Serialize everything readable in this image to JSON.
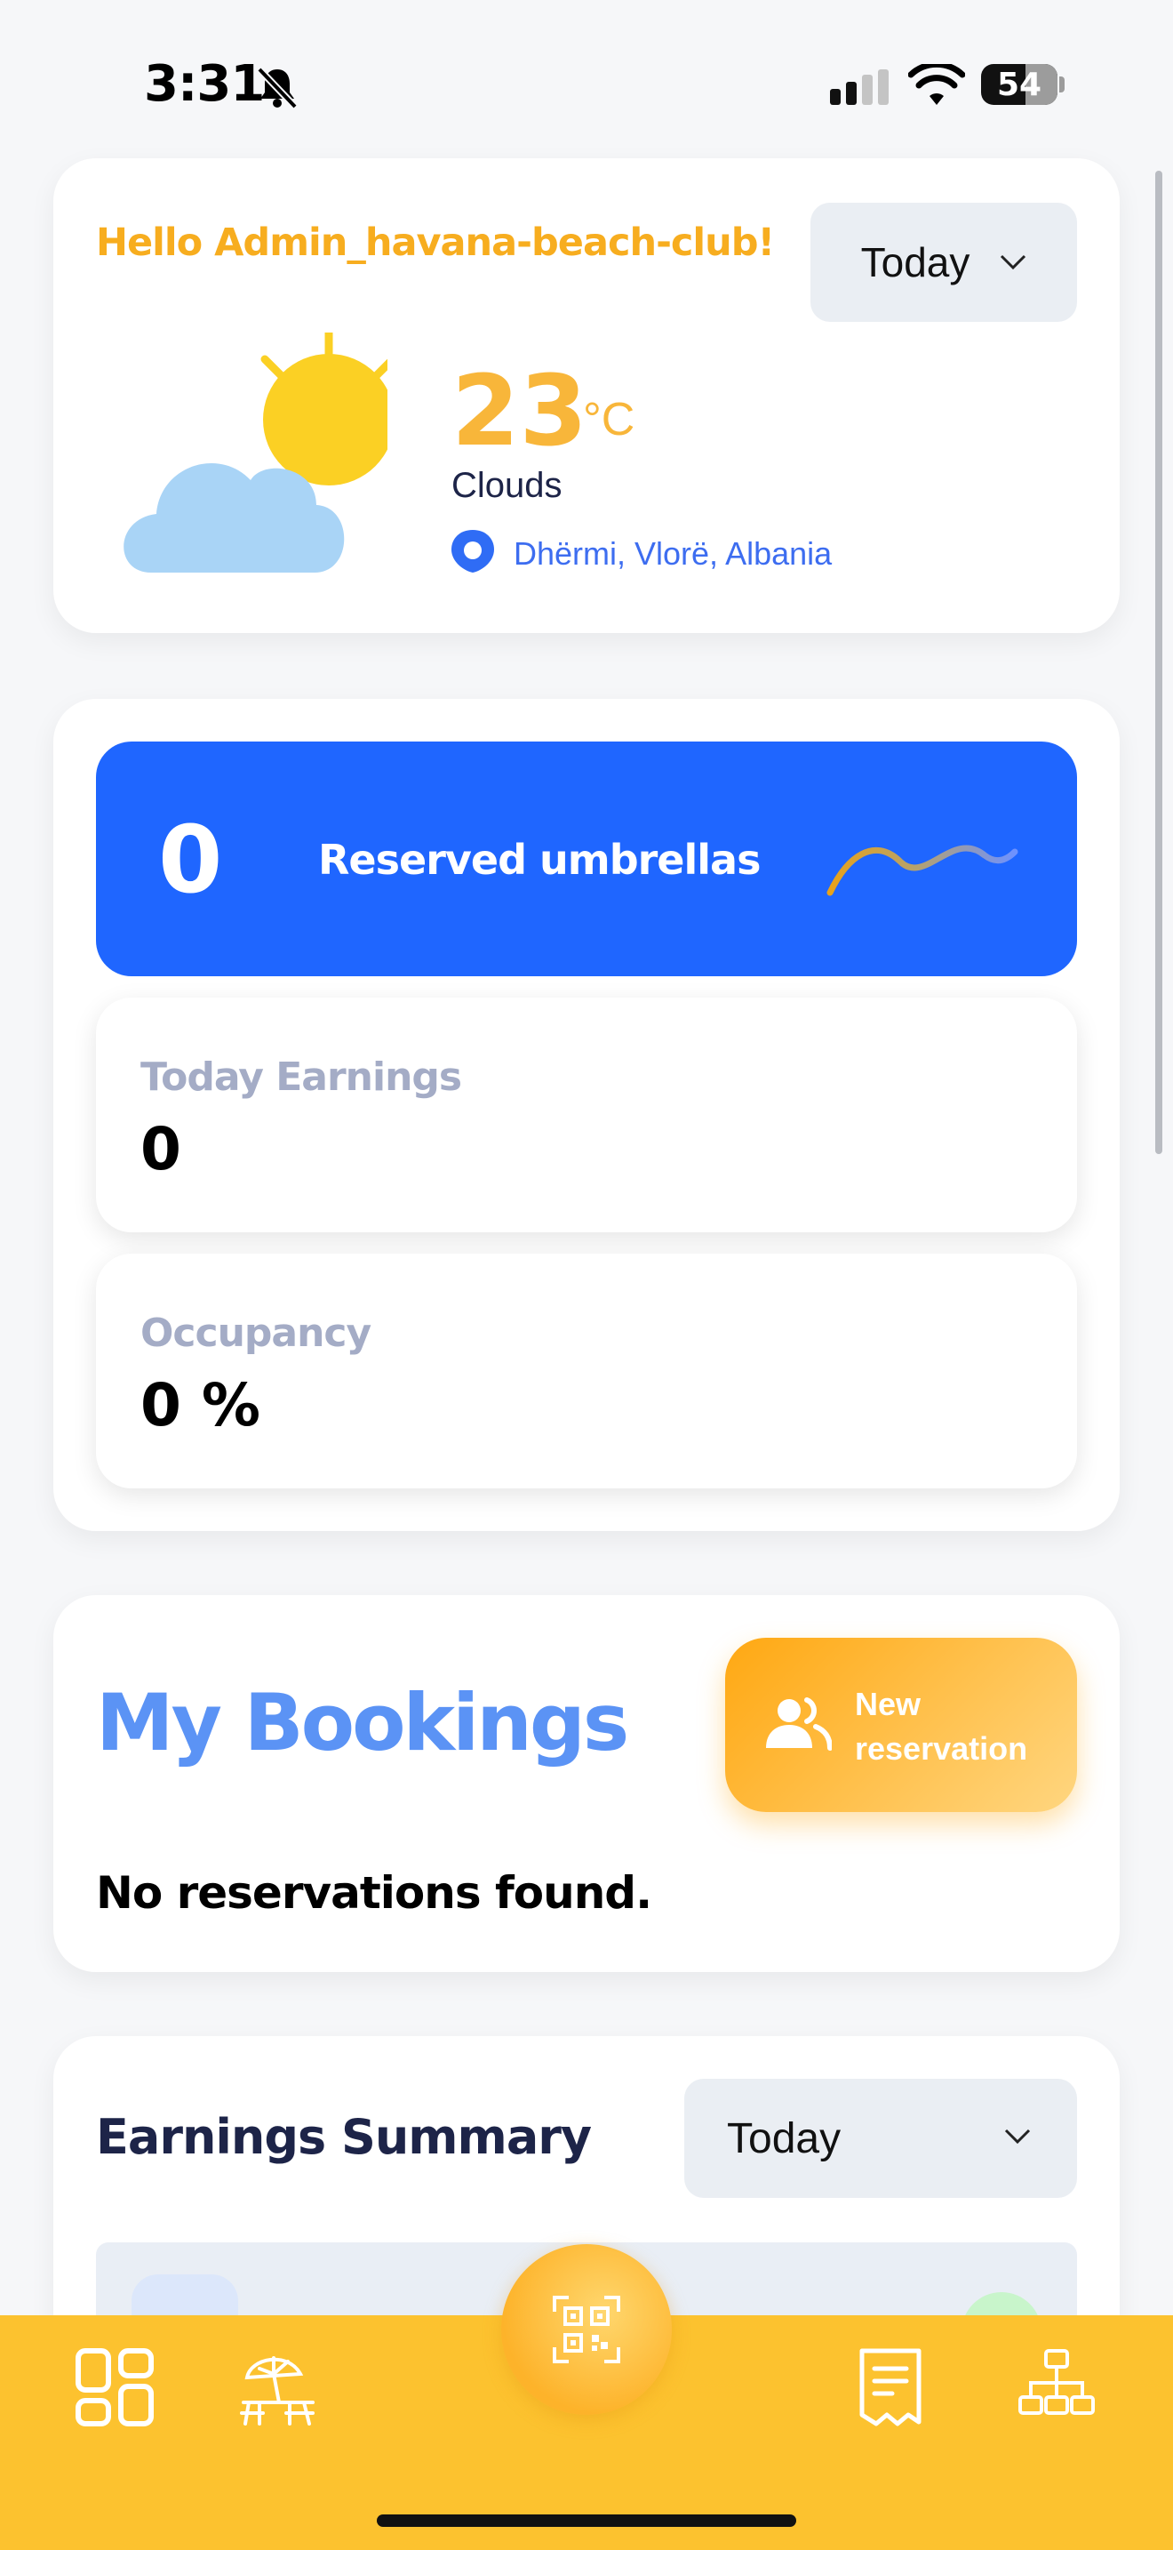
{
  "status_bar": {
    "time": "3:31",
    "battery": "54"
  },
  "weather": {
    "greeting": "Hello Admin_havana-beach-club!",
    "period": "Today",
    "temperature": "23",
    "unit": "°C",
    "condition": "Clouds",
    "location": "Dhërmi, Vlorë, Albania"
  },
  "stats": {
    "reserved_count": "0",
    "reserved_label": "Reserved umbrellas",
    "earnings_label": "Today Earnings",
    "earnings_value": "0",
    "occupancy_label": "Occupancy",
    "occupancy_value": "0 %"
  },
  "bookings": {
    "title": "My Bookings",
    "new_button_label": "New reservation",
    "empty_message": "No reservations found."
  },
  "earnings_summary": {
    "title": "Earnings Summary",
    "period": "Today"
  },
  "colors": {
    "accent_yellow": "#fcc22f",
    "primary_blue": "#1f66ff",
    "greeting_orange": "#f7ad1f"
  },
  "icons": {
    "status": [
      "bell-slash-icon",
      "cellular-signal-icon",
      "wifi-icon",
      "battery-icon"
    ],
    "weather": "sun-behind-cloud-icon",
    "location": "location-pin-icon",
    "nav": [
      "dashboard-grid-icon",
      "umbrella-icon",
      "qr-scan-icon",
      "receipt-icon",
      "hierarchy-icon"
    ]
  }
}
